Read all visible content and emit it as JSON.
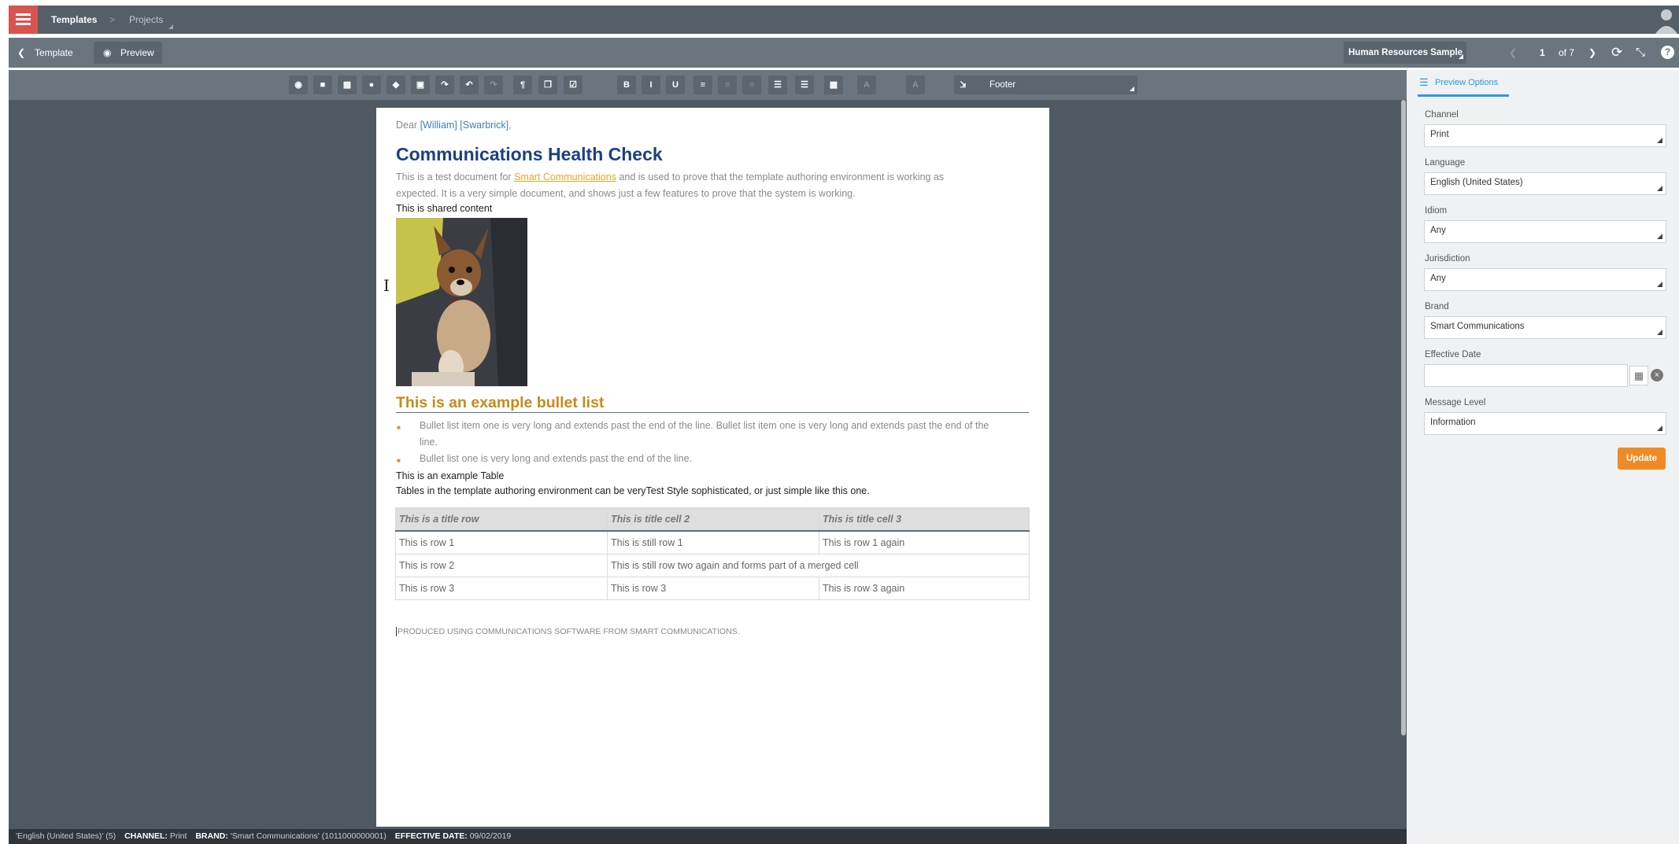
{
  "topbar": {
    "breadcrumb_current": "Templates",
    "breadcrumb_next": "Projects"
  },
  "subbar": {
    "back_label": "Template",
    "preview_label": "Preview",
    "sample_data": "Human Resources Sample Data",
    "page_current": "1",
    "page_total": "of 7"
  },
  "toolbar": {
    "style_select": "Footer",
    "icons": [
      "preview-icon",
      "flag-icon",
      "table-icon",
      "database-icon",
      "layers-icon",
      "binoculars-icon",
      "wrap-icon",
      "undo-icon",
      "redo-icon",
      "paragraph-icon",
      "copy-icon",
      "check-icon",
      "separator",
      "bold-icon",
      "italic-icon",
      "underline-icon",
      "align-left-icon",
      "align-center-icon",
      "align-right-icon",
      "list-icon",
      "numbered-list-icon",
      "grid-icon",
      "text-color-icon",
      "highlight-icon",
      "import-icon"
    ],
    "icon_glyphs": [
      "◉",
      "■",
      "▦",
      "●",
      "◆",
      "▣",
      "↷",
      "↶",
      "↷",
      "¶",
      "❐",
      "☑",
      "",
      "B",
      "I",
      "U",
      "≡",
      "≡",
      "≡",
      "☰",
      "☰",
      "▩",
      "A",
      "A",
      "⇲"
    ]
  },
  "document": {
    "greeting_prefix": "Dear ",
    "first_name": "[William]",
    "last_name": "[Swarbrick]",
    "greeting_suffix": ",",
    "title": "Communications Health Check",
    "intro_part1": "This is a test document for ",
    "intro_link": "Smart Communications",
    "intro_part2": " and is used to prove that the template authoring environment is working as",
    "intro_line2": "expected. It is a very simple document, and shows just a few features to prove that the system is working.",
    "shared_content": "This is shared content",
    "bullet_heading": "This is an example bullet list",
    "bullets": [
      "Bullet list item one is very long and extends past the end of the line. Bullet list item one is very long and extends past the end of the",
      "line.",
      "Bullet list one is very long and extends past the end of the line."
    ],
    "table_caption": "This is an example Table",
    "table_intro": "Tables in the template authoring environment can be veryTest Style sophisticated, or just simple like this one.",
    "table": {
      "headers": [
        "This is a title row",
        "This is title cell 2",
        "This is title cell 3"
      ],
      "rows": [
        [
          "This is row 1",
          "This is still row 1",
          "This is row 1 again"
        ],
        [
          "This is row 2",
          "This is still row two again and forms part of a merged cell"
        ],
        [
          "This is row 3",
          "This is row 3",
          "This is row 3 again"
        ]
      ]
    },
    "footer": "PRODUCED USING COMMUNICATIONS SOFTWARE FROM SMART COMMUNICATIONS."
  },
  "panel": {
    "tab_label": "Preview Options",
    "fields": [
      {
        "label": "Channel",
        "value": "Print"
      },
      {
        "label": "Language",
        "value": "English (United States)"
      },
      {
        "label": "Idiom",
        "value": "Any"
      },
      {
        "label": "Jurisdiction",
        "value": "Any"
      },
      {
        "label": "Brand",
        "value": "Smart Communications"
      },
      {
        "label": "Effective Date",
        "value": ""
      },
      {
        "label": "Message Level",
        "value": "Information"
      }
    ],
    "update_label": "Update"
  },
  "status": {
    "language": "'English (United States)' (5)",
    "channel_label": "CHANNEL:",
    "channel_value": "Print",
    "brand_label": "BRAND:",
    "brand_value": "'Smart Communications' (1011000000001)",
    "date_label": "EFFECTIVE DATE:",
    "date_value": "09/02/2019"
  },
  "colors": {
    "accent_red": "#d9534f",
    "heading_blue": "#1f3f7f",
    "bullet_heading": "#c78a1a",
    "link_orange": "#e8a62a",
    "update_orange": "#f08a24",
    "tab_blue": "#2e9ad8"
  }
}
